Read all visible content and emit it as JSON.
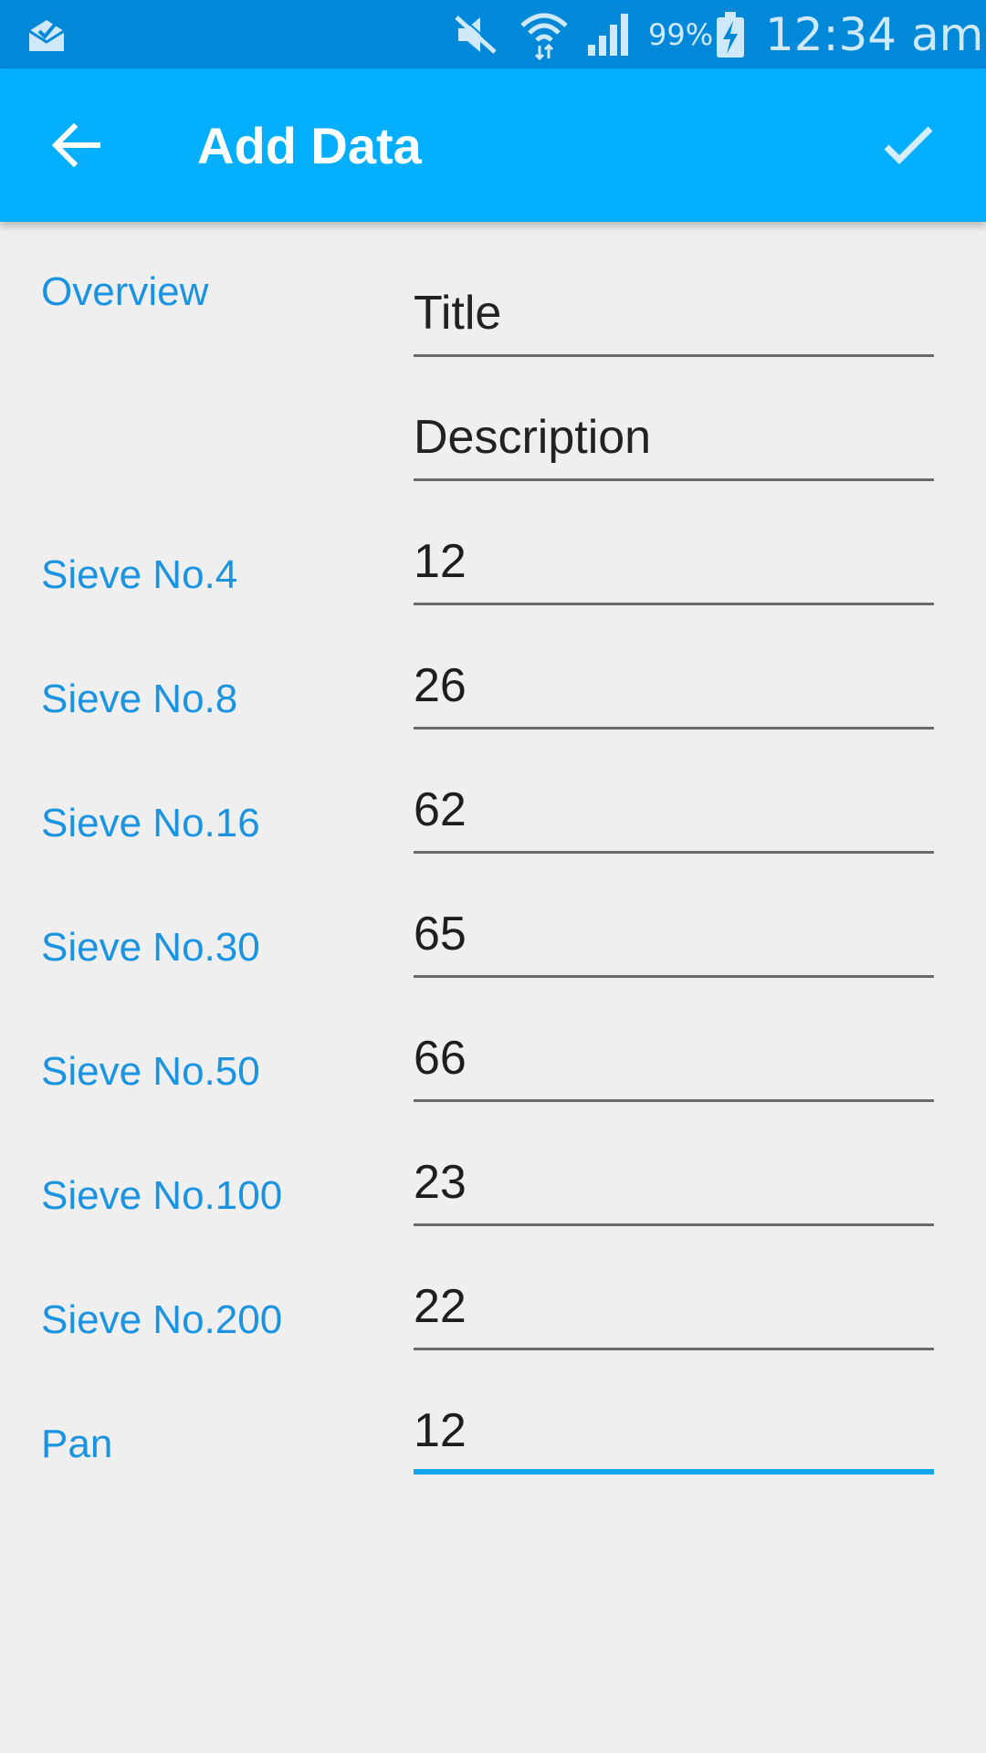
{
  "status_bar": {
    "battery_pct": "99%",
    "time": "12:34 am",
    "icons": [
      "mail-icon",
      "mute-icon",
      "wifi-icon",
      "signal-icon",
      "battery-charging-icon"
    ]
  },
  "app_bar": {
    "title": "Add Data",
    "back_icon": "arrow-back-icon",
    "confirm_icon": "check-icon",
    "color": "#03aefc"
  },
  "overview": {
    "label": "Overview",
    "title_placeholder": "Title",
    "description_placeholder": "Description"
  },
  "sieves": [
    {
      "label": "Sieve No.4",
      "value": "12"
    },
    {
      "label": "Sieve No.8",
      "value": "26"
    },
    {
      "label": "Sieve No.16",
      "value": "62"
    },
    {
      "label": "Sieve No.30",
      "value": "65"
    },
    {
      "label": "Sieve No.50",
      "value": "66"
    },
    {
      "label": "Sieve No.100",
      "value": "23"
    },
    {
      "label": "Sieve No.200",
      "value": "22"
    },
    {
      "label": "Pan",
      "value": "12"
    }
  ],
  "colors": {
    "status_bar": "#0288d8",
    "label": "#1a93e0",
    "focus_underline": "#12a6ec",
    "background": "#efeff0"
  }
}
